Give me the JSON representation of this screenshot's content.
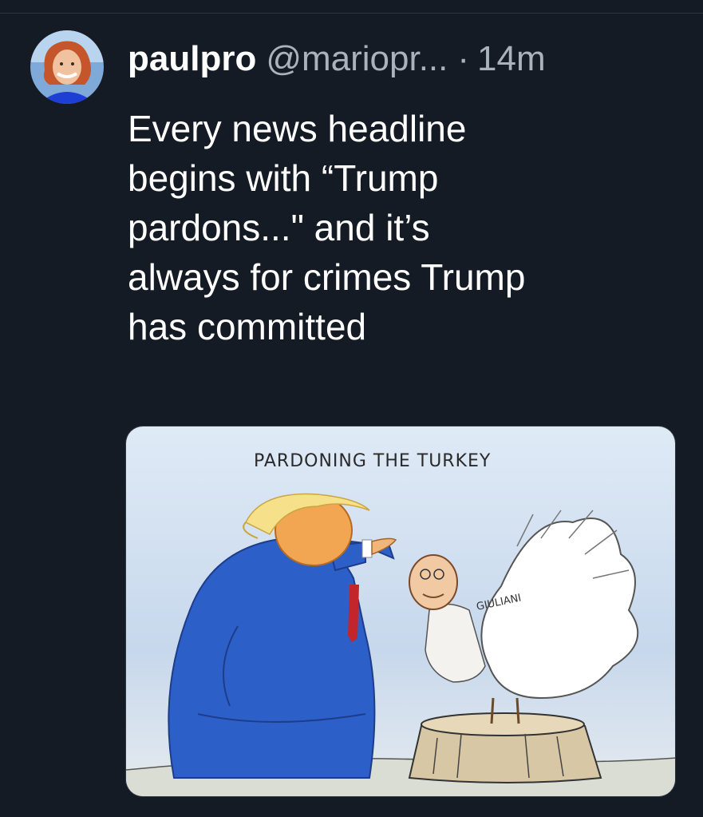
{
  "tweet": {
    "author": {
      "display_name": "paulpro",
      "handle": "@mariopr...",
      "avatar_icon": "profile-photo"
    },
    "separator": "·",
    "timestamp": "14m",
    "text_lines": [
      "Every news headline",
      "begins with “Trump",
      "pardons...\" and it’s",
      "always for crimes Trump",
      "has committed"
    ],
    "media": {
      "caption": "PARDONING THE TURKEY",
      "turkey_label": "GIULIANI"
    }
  },
  "colors": {
    "background": "#151b24",
    "text_primary": "#ffffff",
    "text_secondary": "#a9b2bd"
  }
}
